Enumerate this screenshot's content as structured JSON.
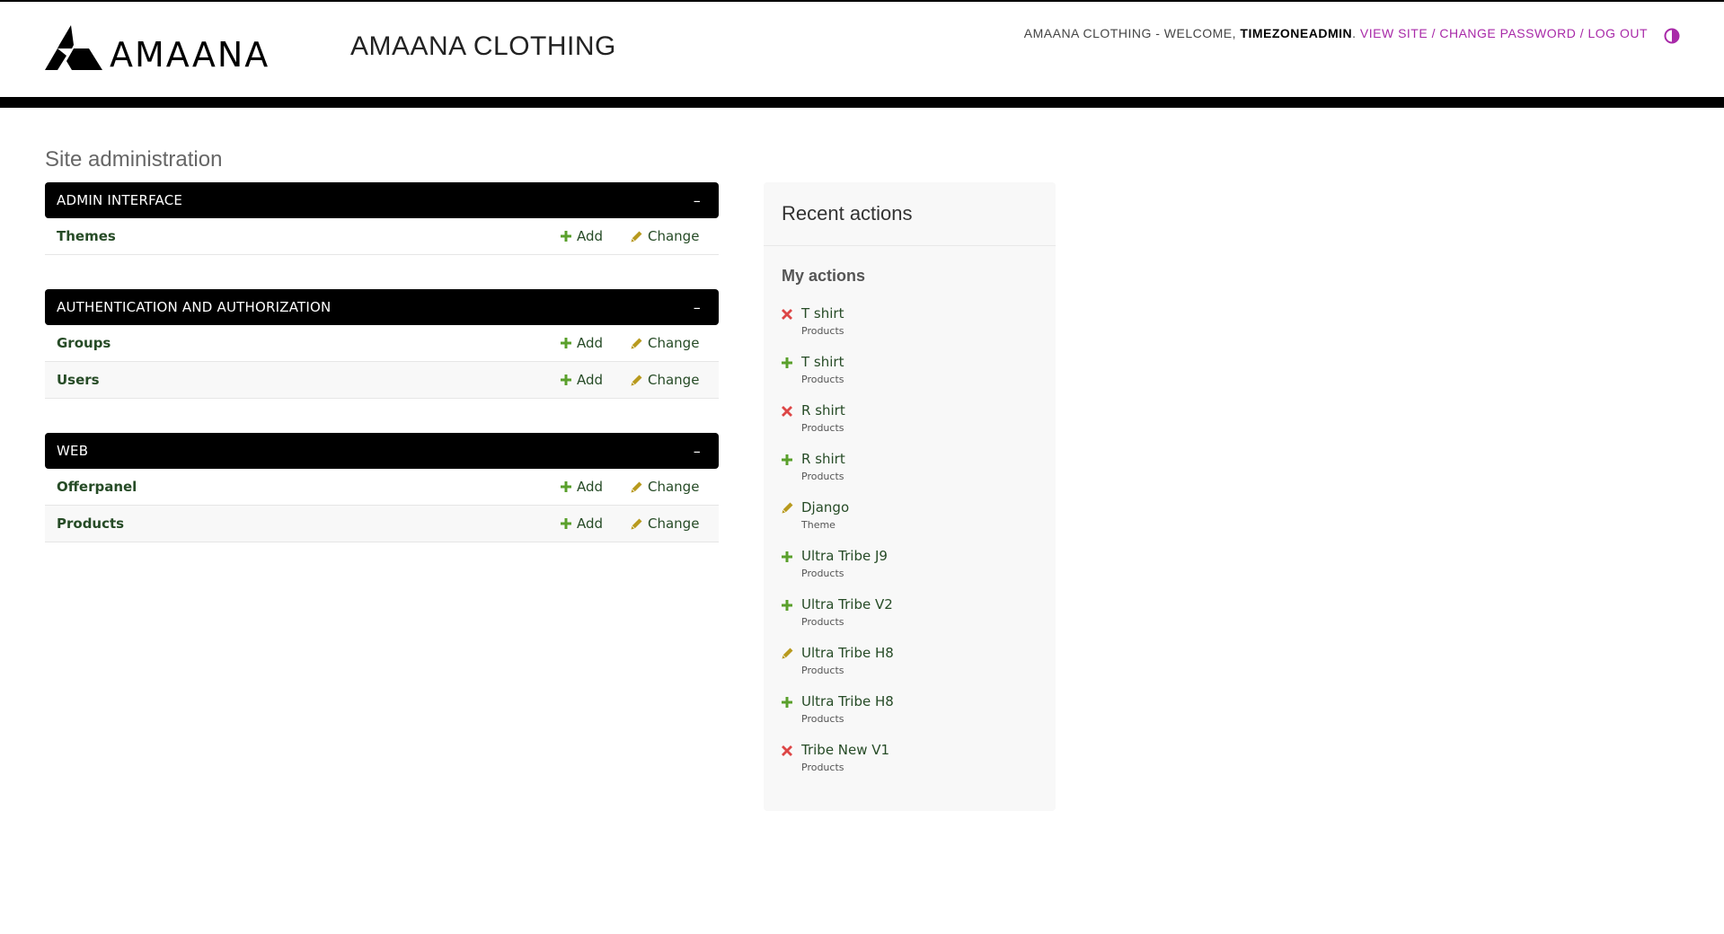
{
  "header": {
    "logo_text": "AMAANA",
    "site_name": "AMAANA CLOTHING",
    "user_tools": {
      "prefix": "AMAANA CLOTHING - WELCOME,",
      "username": "TIMEZONEADMIN",
      "view_site": "VIEW SITE",
      "change_password": "CHANGE PASSWORD",
      "log_out": "LOG OUT",
      "separator": "/"
    }
  },
  "page": {
    "title": "Site administration"
  },
  "labels": {
    "add": "Add",
    "change": "Change",
    "collapse": "–"
  },
  "modules": [
    {
      "caption": "ADMIN INTERFACE",
      "rows": [
        {
          "name": "Themes"
        }
      ]
    },
    {
      "caption": "AUTHENTICATION AND AUTHORIZATION",
      "rows": [
        {
          "name": "Groups"
        },
        {
          "name": "Users"
        }
      ]
    },
    {
      "caption": "WEB",
      "rows": [
        {
          "name": "Offerpanel"
        },
        {
          "name": "Products"
        }
      ]
    }
  ],
  "recent_actions": {
    "title": "Recent actions",
    "subtitle": "My actions",
    "items": [
      {
        "name": "T shirt",
        "type": "Products",
        "action": "delete"
      },
      {
        "name": "T shirt",
        "type": "Products",
        "action": "add"
      },
      {
        "name": "R shirt",
        "type": "Products",
        "action": "delete"
      },
      {
        "name": "R shirt",
        "type": "Products",
        "action": "add"
      },
      {
        "name": "Django",
        "type": "Theme",
        "action": "change"
      },
      {
        "name": "Ultra Tribe J9",
        "type": "Products",
        "action": "add"
      },
      {
        "name": "Ultra Tribe V2",
        "type": "Products",
        "action": "add"
      },
      {
        "name": "Ultra Tribe H8",
        "type": "Products",
        "action": "change"
      },
      {
        "name": "Ultra Tribe H8",
        "type": "Products",
        "action": "add"
      },
      {
        "name": "Tribe New V1",
        "type": "Products",
        "action": "delete"
      }
    ]
  },
  "colors": {
    "header_bar": "#000000",
    "link_accent": "#a829a8",
    "add_icon": "#5aa02c",
    "change_icon": "#b89a1e",
    "delete_icon": "#dd4646",
    "link_text": "#264b26"
  }
}
